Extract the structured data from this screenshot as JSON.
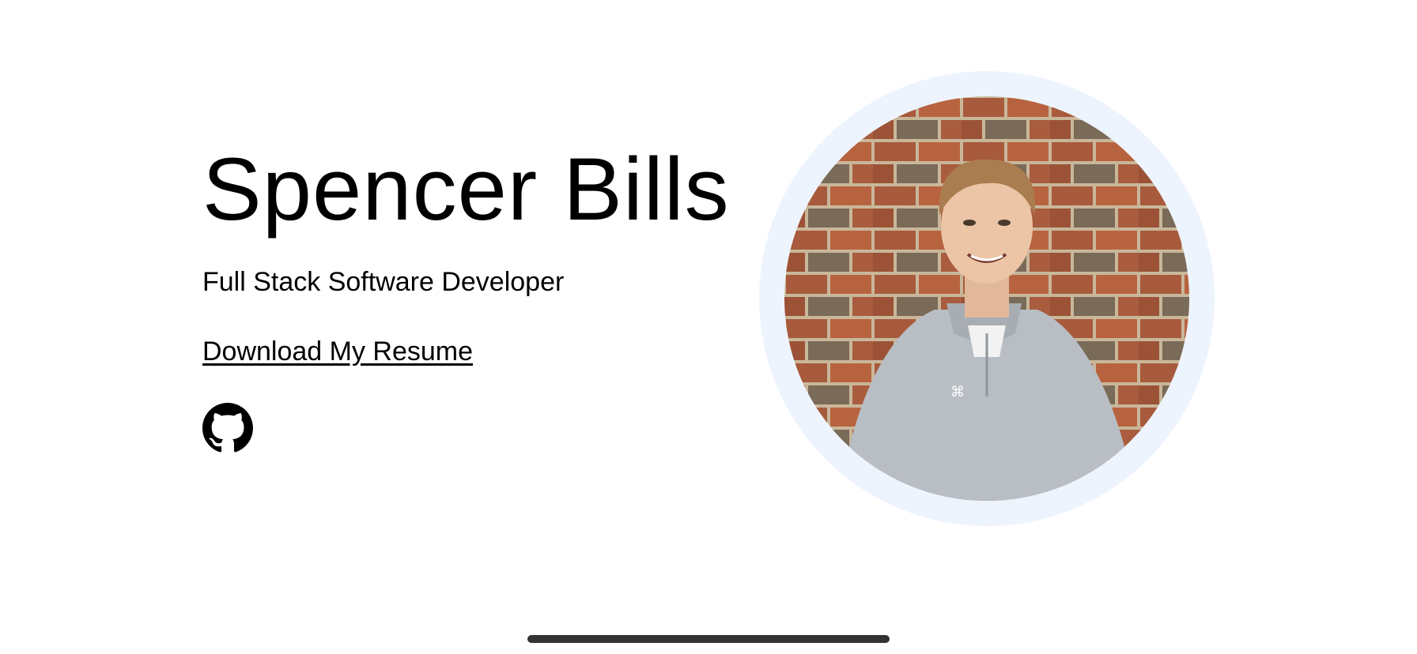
{
  "hero": {
    "name": "Spencer Bills",
    "subtitle": "Full Stack Software Developer",
    "resume_link_label": "Download My Resume",
    "social": [
      {
        "icon": "github-icon"
      }
    ],
    "photo_alt": "Spencer Bills"
  },
  "colors": {
    "photo_ring": "#eef4fd",
    "text": "#000000",
    "home_indicator": "#333333"
  }
}
